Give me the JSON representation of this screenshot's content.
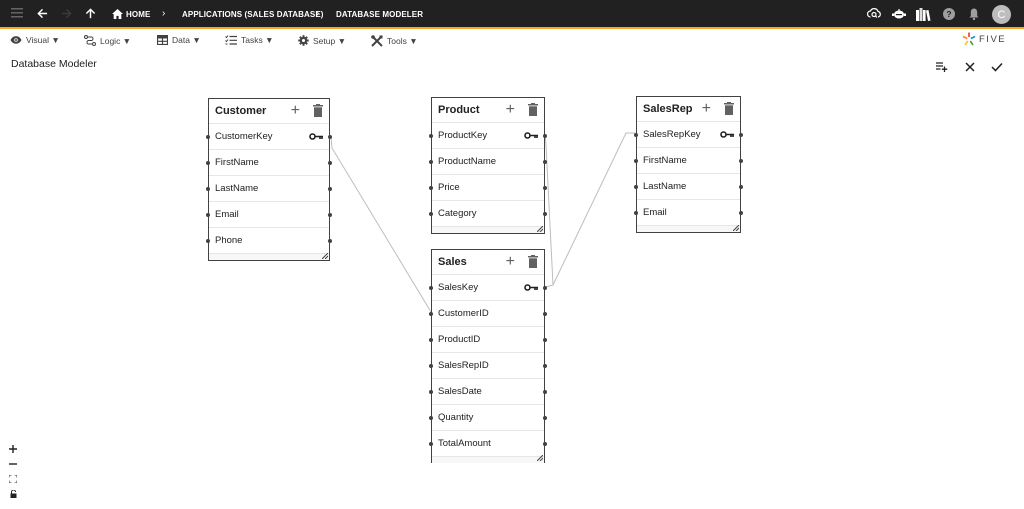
{
  "topbar": {
    "breadcrumbs": [
      "HOME",
      "APPLICATIONS (SALES DATABASE)",
      "DATABASE MODELER"
    ],
    "avatar_initial": "C",
    "accent_color": "#f5a623",
    "icons": [
      "menu-icon",
      "back-arrow-icon",
      "forward-arrow-icon",
      "up-arrow-icon",
      "home-icon",
      "cloud-search-icon",
      "robot-icon",
      "library-icon",
      "help-icon",
      "bell-icon"
    ]
  },
  "menubar": {
    "items": [
      {
        "label": "Visual ▼",
        "icon": "eye-icon"
      },
      {
        "label": "Logic ▼",
        "icon": "logic-icon"
      },
      {
        "label": "Data ▼",
        "icon": "table-icon"
      },
      {
        "label": "Tasks ▼",
        "icon": "checklist-icon"
      },
      {
        "label": "Setup ▼",
        "icon": "gear-icon"
      },
      {
        "label": "Tools ▼",
        "icon": "tools-icon"
      }
    ],
    "logo_text": "FIVE"
  },
  "page": {
    "title": "Database Modeler",
    "actions": [
      "add-table-icon",
      "close-icon",
      "check-icon"
    ]
  },
  "tables": [
    {
      "name": "Customer",
      "fields": [
        "CustomerKey",
        "FirstName",
        "LastName",
        "Email",
        "Phone"
      ],
      "primary_key": "CustomerKey"
    },
    {
      "name": "Product",
      "fields": [
        "ProductKey",
        "ProductName",
        "Price",
        "Category"
      ],
      "primary_key": "ProductKey"
    },
    {
      "name": "SalesRep",
      "fields": [
        "SalesRepKey",
        "FirstName",
        "LastName",
        "Email"
      ],
      "primary_key": "SalesRepKey"
    },
    {
      "name": "Sales",
      "fields": [
        "SalesKey",
        "CustomerID",
        "ProductID",
        "SalesRepID",
        "SalesDate",
        "Quantity",
        "TotalAmount"
      ],
      "primary_key": "SalesKey"
    }
  ],
  "relationships": [
    {
      "from": "Customer.CustomerKey",
      "to": "Sales.CustomerID"
    },
    {
      "from": "Product.ProductKey",
      "to": "Sales.SalesKey"
    },
    {
      "from": "SalesRep.SalesRepKey",
      "to": "Sales.SalesKey"
    }
  ],
  "zoom_controls": [
    "zoom-in",
    "zoom-out",
    "fit-view",
    "lock"
  ]
}
